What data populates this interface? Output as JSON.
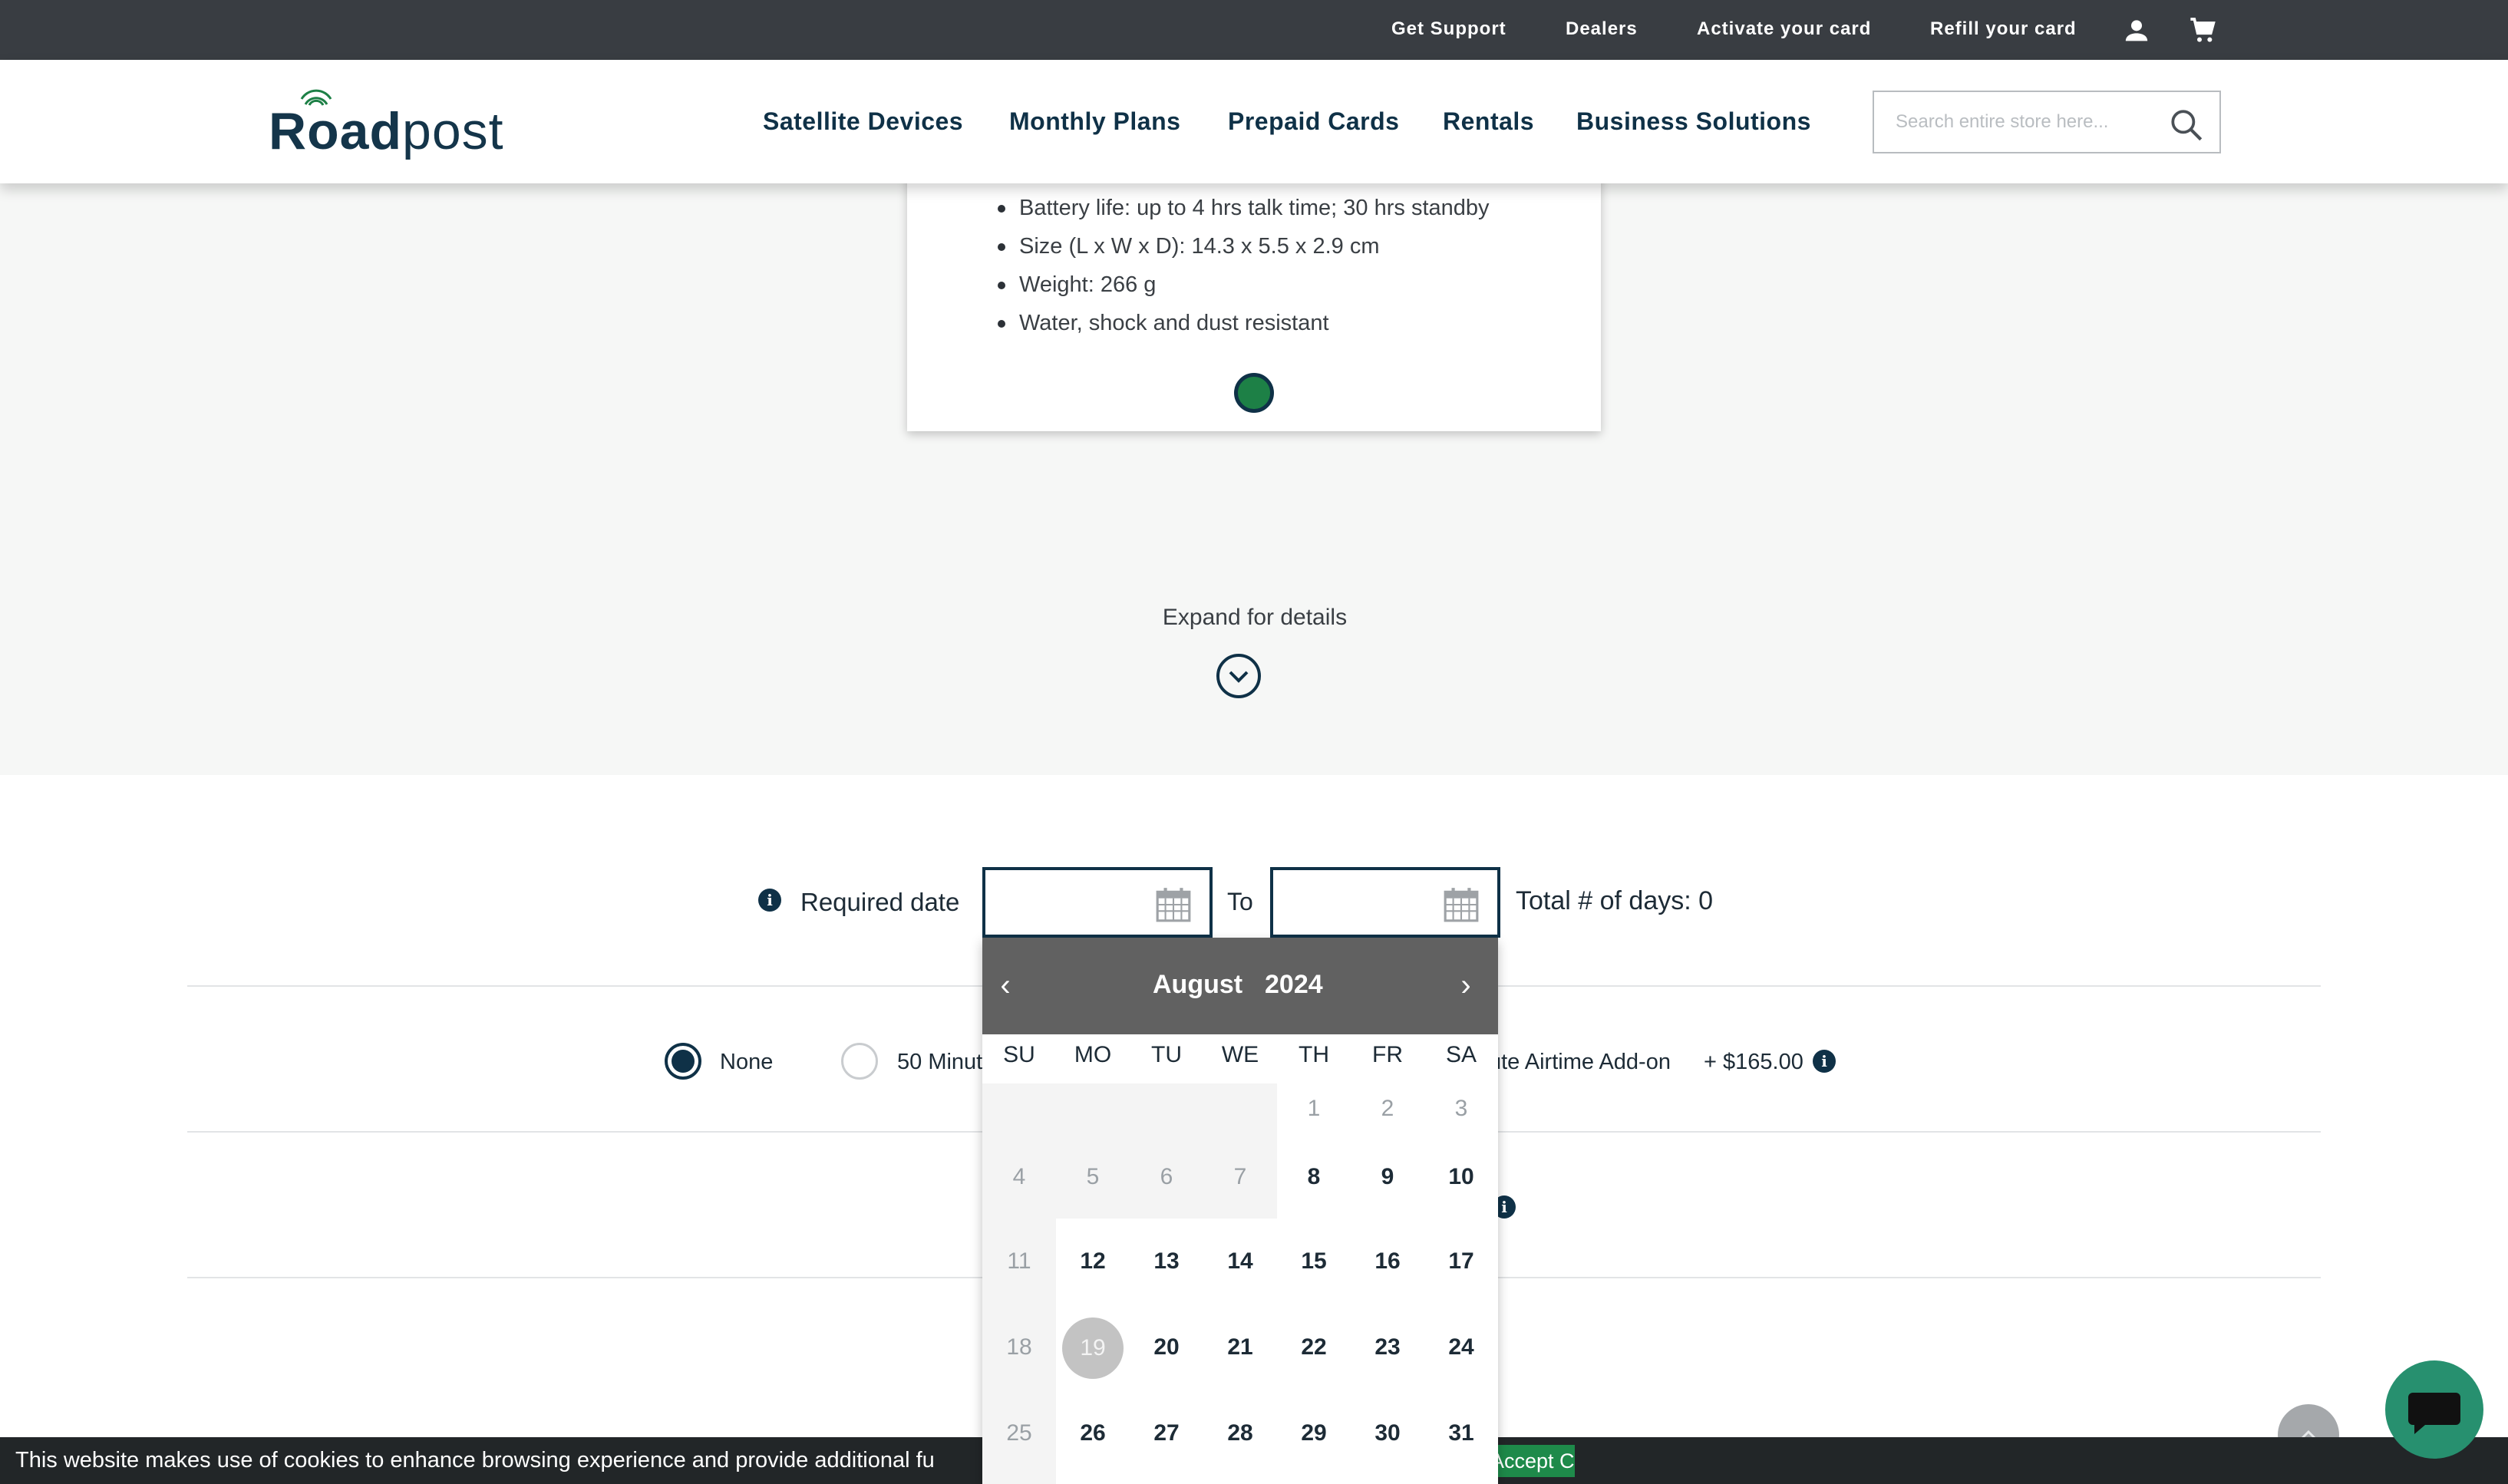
{
  "topbar": {
    "links": [
      "Get Support",
      "Dealers",
      "Activate your card",
      "Refill your card"
    ],
    "account_icon": "user-icon",
    "cart_icon": "cart-icon"
  },
  "header": {
    "logo": "Roadpost",
    "nav": [
      "Satellite Devices",
      "Monthly Plans",
      "Prepaid Cards",
      "Rentals",
      "Business Solutions"
    ],
    "search_placeholder": "Search entire store here..."
  },
  "product": {
    "specs": [
      "Battery life: up to 4 hrs talk time; 30 hrs standby",
      "Size (L x W x D): 14.3 x 5.5 x 2.9 cm",
      "Weight: 266 g",
      "Water, shock and dust resistant"
    ],
    "expand_label": "Expand for details"
  },
  "rental": {
    "required_date_label": "Required date",
    "to_label": "To",
    "total_days_label": "Total # of days: 0",
    "start_date_value": "",
    "end_date_value": ""
  },
  "addons": {
    "options": [
      {
        "label": "None",
        "selected": true
      },
      {
        "label": "50 Minut",
        "selected": false
      }
    ],
    "partial_label": "ute Airtime Add-on",
    "price": "+ $165.00"
  },
  "datepicker": {
    "month": "August",
    "year": "2024",
    "days_of_week": [
      "SU",
      "MO",
      "TU",
      "WE",
      "TH",
      "FR",
      "SA"
    ],
    "weeks": [
      [
        "",
        "",
        "",
        "",
        "1",
        "2",
        "3"
      ],
      [
        "4",
        "5",
        "6",
        "7",
        "8",
        "9",
        "10"
      ],
      [
        "11",
        "12",
        "13",
        "14",
        "15",
        "16",
        "17"
      ],
      [
        "18",
        "19",
        "20",
        "21",
        "22",
        "23",
        "24"
      ],
      [
        "25",
        "26",
        "27",
        "28",
        "29",
        "30",
        "31"
      ]
    ],
    "today": "19"
  },
  "cookie": {
    "text": "This website makes use of cookies to enhance browsing experience and provide additional fu",
    "button": "Accept Cookies"
  },
  "colors": {
    "navy": "#0f3147",
    "green": "#1d8046",
    "topbar": "#393d42",
    "datepicker_header": "#616161"
  }
}
